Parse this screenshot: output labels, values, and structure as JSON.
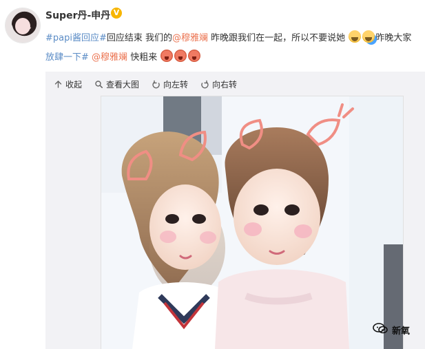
{
  "post": {
    "username": "Super丹-申丹",
    "verified_badge": "V",
    "line1": {
      "hashtag": "#papi酱回应#",
      "text_after_hashtag": "回应结束 我们的",
      "mention": "@穆雅斓",
      "text_after_mention": " 昨晚跟我们在一起，所以不要说她",
      "text_after_emojis": "昨晚大家"
    },
    "line2": {
      "hashtag": "放肆一下#",
      "mention": "@穆雅斓",
      "text": " 快粗来"
    }
  },
  "image_toolbar": {
    "collapse_label": "收起",
    "view_large_label": "查看大图",
    "rotate_left_label": "向左转",
    "rotate_right_label": "向右转"
  },
  "watermark": {
    "text": "新氧"
  },
  "icons": {
    "collapse": "arrow-up-icon",
    "view_large": "magnifier-icon",
    "rotate_left": "rotate-left-icon",
    "rotate_right": "rotate-right-icon"
  },
  "colors": {
    "link": "#5b8cc6",
    "mention": "#eb7350",
    "badge": "#f7b500"
  }
}
